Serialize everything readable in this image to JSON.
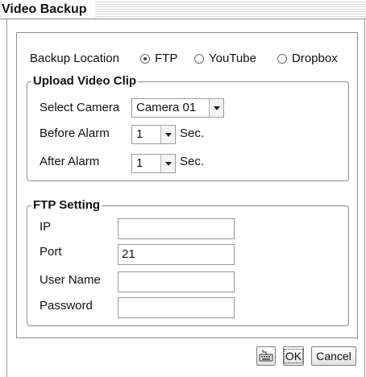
{
  "window": {
    "title": "Video Backup"
  },
  "backup_location": {
    "label": "Backup Location",
    "options": [
      "FTP",
      "YouTube",
      "Dropbox"
    ],
    "selected": "FTP"
  },
  "upload_clip": {
    "legend": "Upload Video Clip",
    "camera_label": "Select Camera",
    "camera_value": "Camera 01",
    "before_label": "Before Alarm",
    "before_value": "1",
    "after_label": "After Alarm",
    "after_value": "1",
    "unit": "Sec."
  },
  "ftp": {
    "legend": "FTP Setting",
    "ip_label": "IP",
    "ip_value": "",
    "port_label": "Port",
    "port_value": "21",
    "user_label": "User Name",
    "user_value": "",
    "password_label": "Password",
    "password_value": ""
  },
  "buttons": {
    "ok_label": "OK",
    "cancel_label": "Cancel",
    "keyboard_icon": "keyboard-icon"
  }
}
